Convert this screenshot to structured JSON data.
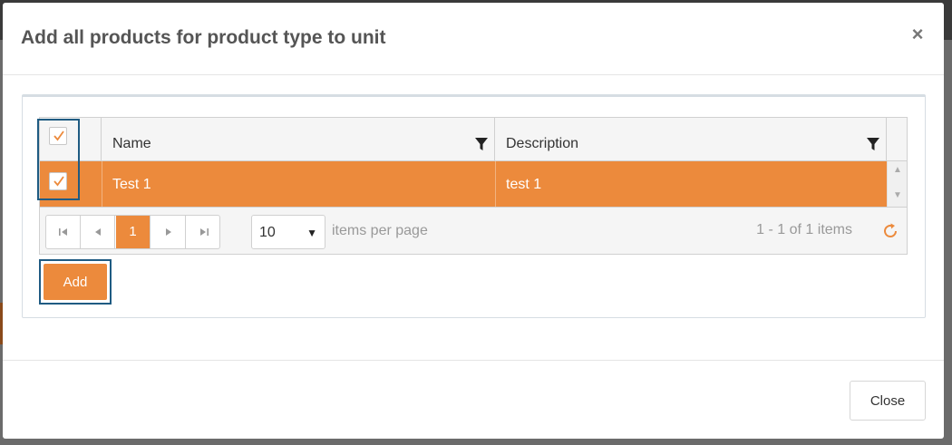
{
  "modal": {
    "title": "Add all products for product type to unit",
    "close_icon": "close-icon"
  },
  "grid": {
    "columns": [
      {
        "label": "Name",
        "icon": "filter-icon"
      },
      {
        "label": "Description",
        "icon": "filter-icon"
      }
    ],
    "header_checkbox_checked": true,
    "rows": [
      {
        "checked": true,
        "name": "Test 1",
        "description": "test 1",
        "selected": true
      }
    ]
  },
  "pager": {
    "current_page": "1",
    "page_size": "10",
    "items_per_page_label": "items per page",
    "range_text": "1 - 1 of 1 items"
  },
  "actions": {
    "add_label": "Add",
    "close_label": "Close"
  },
  "colors": {
    "accent": "#ec8a3c",
    "highlight_border": "#1f5b82"
  }
}
